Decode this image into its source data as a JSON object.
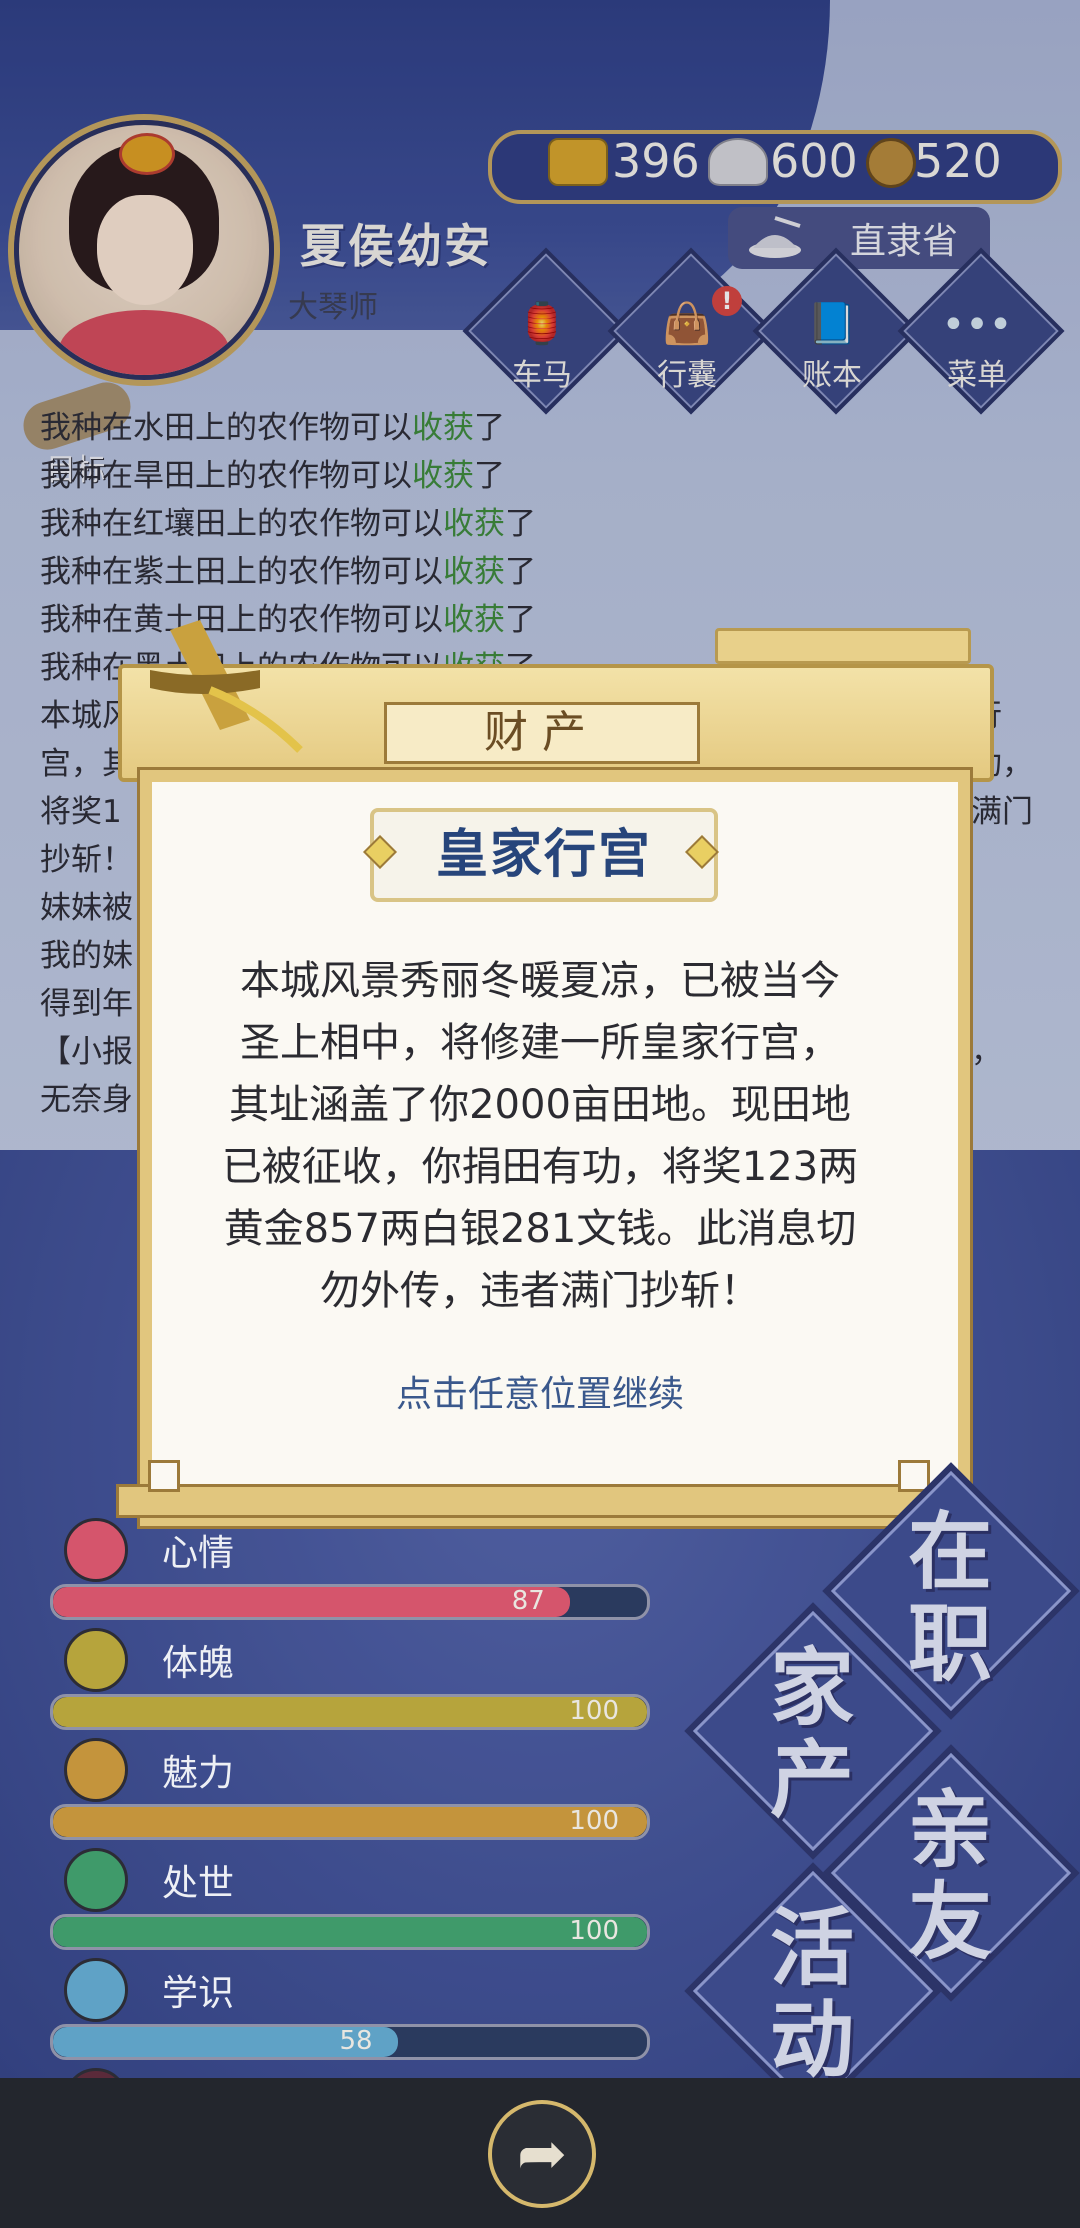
{
  "character": {
    "name": "夏侯幼安",
    "title": "大琴师"
  },
  "currency": [
    {
      "icon": "gold-ingot-icon",
      "value": "396"
    },
    {
      "icon": "silver-ingot-icon",
      "value": "600"
    },
    {
      "icon": "copper-coin-icon",
      "value": "520"
    }
  ],
  "location": "直隶省",
  "nav": [
    {
      "label": "车马",
      "icon": "carriage-icon"
    },
    {
      "label": "行囊",
      "icon": "bag-icon",
      "badge": "!"
    },
    {
      "label": "账本",
      "icon": "ledger-icon"
    },
    {
      "label": "菜单",
      "icon": "menu-icon",
      "glyph": "•••"
    }
  ],
  "goal_label": "目标",
  "log": [
    {
      "pre": "我种在水田上的农作物可以",
      "hl": "收获",
      "post": "了"
    },
    {
      "pre": "我种在旱田上的农作物可以",
      "hl": "收获",
      "post": "了"
    },
    {
      "pre": "我种在红壤田上的农作物可以",
      "hl": "收获",
      "post": "了"
    },
    {
      "pre": "我种在紫土田上的农作物可以",
      "hl": "收获",
      "post": "了"
    },
    {
      "pre": "我种在黄土田上的农作物可以",
      "hl": "收获",
      "post": "了"
    },
    {
      "pre": "我种在黑土田上的农作物可以",
      "hl": "收获",
      "post": "了"
    },
    {
      "pre": "本城风",
      "hl": "",
      "post": ""
    },
    {
      "pre": "宫，其",
      "hl": "",
      "post": ""
    },
    {
      "pre": "将奖1",
      "hl": "",
      "post": ""
    },
    {
      "pre": "抄斩！",
      "hl": "",
      "post": ""
    },
    {
      "pre": "妹妹被",
      "hl": "",
      "post": ""
    },
    {
      "pre": "我的妹",
      "hl": "",
      "post": ""
    },
    {
      "pre": "得到年",
      "hl": "",
      "post": ""
    },
    {
      "pre": "【小报",
      "hl": "",
      "post": ""
    },
    {
      "pre": "无奈身",
      "hl": "",
      "post": ""
    }
  ],
  "log_right": [
    "家行",
    "有功，",
    "者满门",
    "",
    "",
    "",
    "",
    "劫，"
  ],
  "modal": {
    "header": "财产",
    "subtitle": "皇家行宫",
    "message": "本城风景秀丽冬暖夏凉，已被当今圣上相中，将修建一所皇家行宫，其址涵盖了你2000亩田地。现田地已被征收，你捐田有功，将奖123两黄金857两白银281文钱。此消息切勿外传，违者满门抄斩！",
    "message_lines": [
      "本城风景秀丽冬暖夏凉，已被当今",
      "圣上相中，将修建一所皇家行宫，",
      "其址涵盖了你2000亩田地。现田地",
      "已被征收，你捐田有功，将奖123两",
      "黄金857两白银281文钱。此消息切",
      "勿外传，违者满门抄斩！"
    ],
    "continue": "点击任意位置继续"
  },
  "stats": [
    {
      "label": "心情",
      "value": "87",
      "fraction": 0.87,
      "color": "#d5556c",
      "icon": "flower-icon"
    },
    {
      "label": "体魄",
      "value": "100",
      "fraction": 1.0,
      "color": "#b6a43c",
      "icon": "armor-icon"
    },
    {
      "label": "魅力",
      "value": "100",
      "fraction": 1.0,
      "color": "#c4943c",
      "icon": "mirror-icon"
    },
    {
      "label": "处世",
      "value": "100",
      "fraction": 1.0,
      "color": "#3f9a6a",
      "icon": "scroll-hat-icon"
    },
    {
      "label": "学识",
      "value": "58",
      "fraction": 0.58,
      "color": "#5fa2c6",
      "icon": "books-icon"
    },
    {
      "label": "德行",
      "value": "100",
      "fraction": 1.0,
      "color": "#5a2a3a",
      "icon": "medal-icon"
    }
  ],
  "right_menu": [
    {
      "text": "在职"
    },
    {
      "text": "家产"
    },
    {
      "text": "亲友"
    },
    {
      "text": "活动"
    }
  ],
  "share_label": "➦"
}
